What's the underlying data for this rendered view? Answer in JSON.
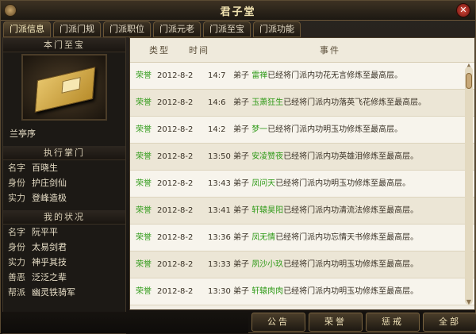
{
  "window": {
    "title": "君子堂"
  },
  "tabs": [
    "门派信息",
    "门派门规",
    "门派职位",
    "门派元老",
    "门派至宝",
    "门派功能"
  ],
  "left": {
    "treasure_header": "本门至宝",
    "treasure_name": "兰亭序",
    "leader_header": "执行掌门",
    "leader": [
      {
        "k": "名字",
        "v": "百晓生"
      },
      {
        "k": "身份",
        "v": "护庄剑仙"
      },
      {
        "k": "实力",
        "v": "登峰造极"
      }
    ],
    "me_header": "我的状况",
    "me": [
      {
        "k": "名字",
        "v": "阮平平"
      },
      {
        "k": "身份",
        "v": "太易剑君"
      },
      {
        "k": "实力",
        "v": "神乎其技"
      },
      {
        "k": "善恶",
        "v": "泛泛之辈"
      },
      {
        "k": "帮派",
        "v": "幽灵铁骑军"
      }
    ]
  },
  "table": {
    "headers": {
      "type": "类型",
      "time": "时间",
      "event": "事件"
    },
    "rows": [
      {
        "type": "荣誉",
        "date": "2012-8-2",
        "time": "14:7",
        "pre": "弟子",
        "name": "雷禅",
        "post": "已经将门派内功花无言修炼至最高层。"
      },
      {
        "type": "荣誉",
        "date": "2012-8-2",
        "time": "14:6",
        "pre": "弟子",
        "name": "玉萧狂生",
        "post": "已经将门派内功落英飞花修炼至最高层。"
      },
      {
        "type": "荣誉",
        "date": "2012-8-2",
        "time": "14:2",
        "pre": "弟子",
        "name": "梦一",
        "post": "已经将门派内功明玉功修炼至最高层。"
      },
      {
        "type": "荣誉",
        "date": "2012-8-2",
        "time": "13:50",
        "pre": "弟子",
        "name": "安凌赞夜",
        "post": "已经将门派内功英雄泪修炼至最高层。"
      },
      {
        "type": "荣誉",
        "date": "2012-8-2",
        "time": "13:43",
        "pre": "弟子",
        "name": "凤问天",
        "post": "已经将门派内功明玉功修炼至最高层。"
      },
      {
        "type": "荣誉",
        "date": "2012-8-2",
        "time": "13:41",
        "pre": "弟子",
        "name": "轩辕昊阳",
        "post": "已经将门派内功清流法修炼至最高层。"
      },
      {
        "type": "荣誉",
        "date": "2012-8-2",
        "time": "13:36",
        "pre": "弟子",
        "name": "凤无情",
        "post": "已经将门派内功忘情天书修炼至最高层。"
      },
      {
        "type": "荣誉",
        "date": "2012-8-2",
        "time": "13:33",
        "pre": "弟子",
        "name": "夙沙小玖",
        "post": "已经将门派内功明玉功修炼至最高层。"
      },
      {
        "type": "荣誉",
        "date": "2012-8-2",
        "time": "13:30",
        "pre": "弟子",
        "name": "轩辕肉肉",
        "post": "已经将门派内功明玉功修炼至最高层。"
      }
    ]
  },
  "buttons": [
    "公告",
    "荣誉",
    "惩戒",
    "全部"
  ]
}
